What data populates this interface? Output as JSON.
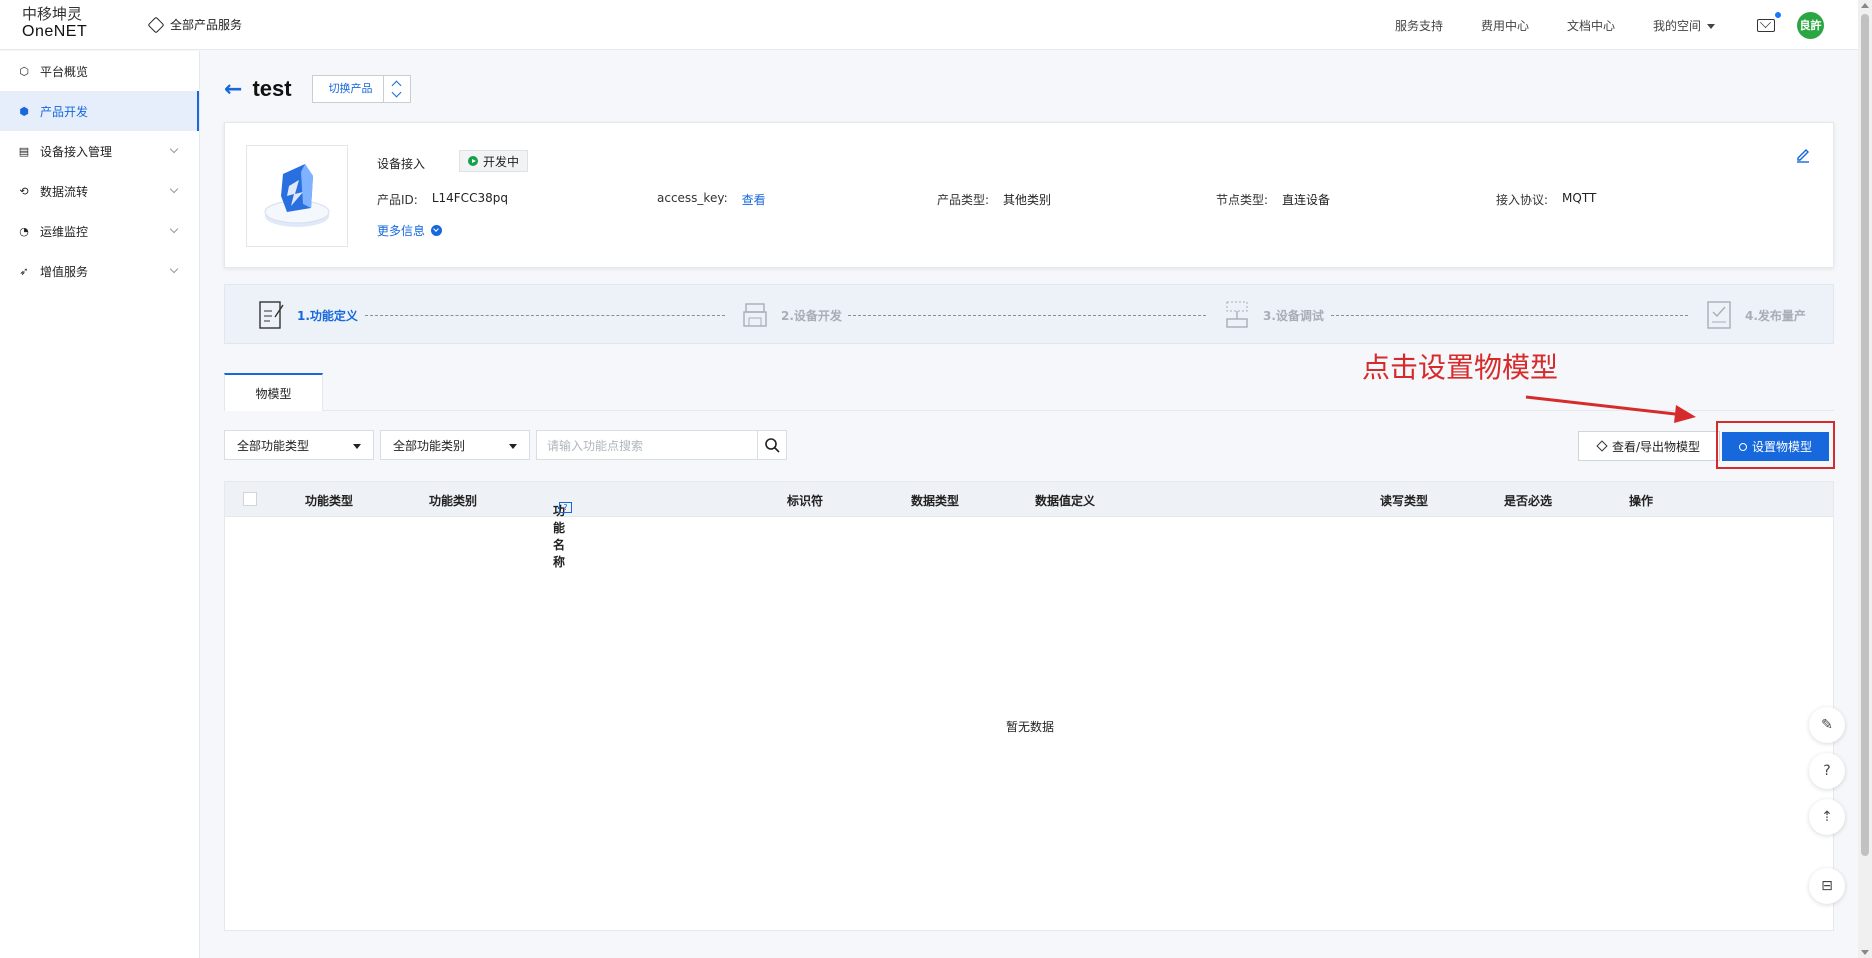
{
  "header": {
    "logo_cn": "中移坤灵",
    "logo_en": "OneNET",
    "all_products": "全部产品服务",
    "nav": [
      "服务支持",
      "费用中心",
      "文档中心"
    ],
    "my_space": "我的空间",
    "avatar_text": "良許"
  },
  "sidebar": {
    "items": [
      {
        "label": "平台概览",
        "icon": "hexagon-icon",
        "active": false
      },
      {
        "label": "产品开发",
        "icon": "cube-icon",
        "active": true
      },
      {
        "label": "设备接入管理",
        "icon": "device-icon",
        "active": false
      },
      {
        "label": "数据流转",
        "icon": "flow-icon",
        "active": false
      },
      {
        "label": "运维监控",
        "icon": "pie-icon",
        "active": false
      },
      {
        "label": "增值服务",
        "icon": "plane-icon",
        "active": false
      }
    ]
  },
  "page": {
    "title": "test",
    "switch_label": "切换产品"
  },
  "product": {
    "category": "设备接入",
    "status": "开发中",
    "fields": [
      {
        "key": "产品ID:",
        "value": "L14FCC38pq"
      },
      {
        "key": "access_key:",
        "value": "查看"
      },
      {
        "key": "产品类型:",
        "value": "其他类别"
      },
      {
        "key": "节点类型:",
        "value": "直连设备"
      },
      {
        "key": "接入协议:",
        "value": "MQTT"
      }
    ],
    "more_info": "更多信息"
  },
  "steps": [
    {
      "label": "1.功能定义",
      "active": true
    },
    {
      "label": "2.设备开发",
      "active": false
    },
    {
      "label": "3.设备调试",
      "active": false
    },
    {
      "label": "4.发布量产",
      "active": false
    }
  ],
  "tabs": [
    "物模型"
  ],
  "annotation": "点击设置物模型",
  "filters": {
    "type": "全部功能类型",
    "category": "全部功能类别",
    "search_placeholder": "请输入功能点搜索"
  },
  "buttons": {
    "export": "查看/导出物模型",
    "set_model": "设置物模型"
  },
  "table": {
    "columns": [
      "功能类型",
      "功能类别",
      "功能名称",
      "标识符",
      "数据类型",
      "数据值定义",
      "读写类型",
      "是否必选",
      "操作"
    ],
    "empty_text": "暂无数据"
  },
  "colors": {
    "accent": "#1668dc",
    "annotation": "#d62b2b",
    "status_green": "#14a04d"
  }
}
